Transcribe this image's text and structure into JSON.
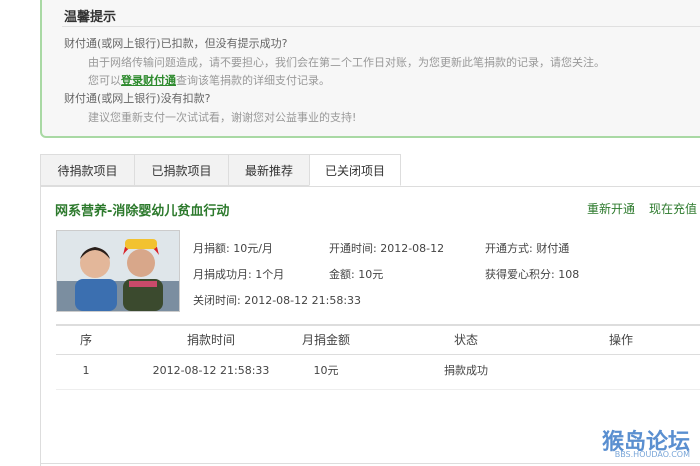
{
  "tip": {
    "title": "温馨提示",
    "q1": "财付通(或网上银行)已扣款，但没有提示成功?",
    "a1": "由于网络传输问题造成，请不要担心，我们会在第二个工作日对账，为您更新此笔捐款的记录，请您关注。",
    "a2_pre": "您可以",
    "a2_link": "登录财付通",
    "a2_post": "查询该笔捐款的详细支付记录。",
    "q2": "财付通(或网上银行)没有扣款?",
    "a3": "建议您重新支付一次试试看，谢谢您对公益事业的支持!"
  },
  "tabs": [
    "待捐款项目",
    "已捐款项目",
    "最新推荐",
    "已关闭项目"
  ],
  "project": {
    "title": "网系营养-消除婴幼儿贫血行动",
    "reopen": "重新开通",
    "recharge": "现在充值",
    "monthly_label": "月捐额:",
    "monthly_value": "10元/月",
    "open_time_label": "开通时间:",
    "open_time_value": "2012-08-12",
    "method_label": "开通方式:",
    "method_value": "财付通",
    "success_label": "月捐成功月:",
    "success_value": "1个月",
    "amount_label": "金额:",
    "amount_value": "10元",
    "points_label": "获得爱心积分:",
    "points_value": "108",
    "close_label": "关闭时间:",
    "close_value": "2012-08-12 21:58:33"
  },
  "table": {
    "headers": [
      "序",
      "捐款时间",
      "月捐金额",
      "状态",
      "操作"
    ],
    "rows": [
      {
        "no": "1",
        "time": "2012-08-12 21:58:33",
        "amount": "10元",
        "status": "捐款成功",
        "op": ""
      }
    ]
  },
  "watermark": {
    "text": "猴岛论坛",
    "url": "BBS.HOUDAO.COM"
  },
  "colors": {
    "accent": "#2d7a2d",
    "border": "#a9d9a4"
  }
}
